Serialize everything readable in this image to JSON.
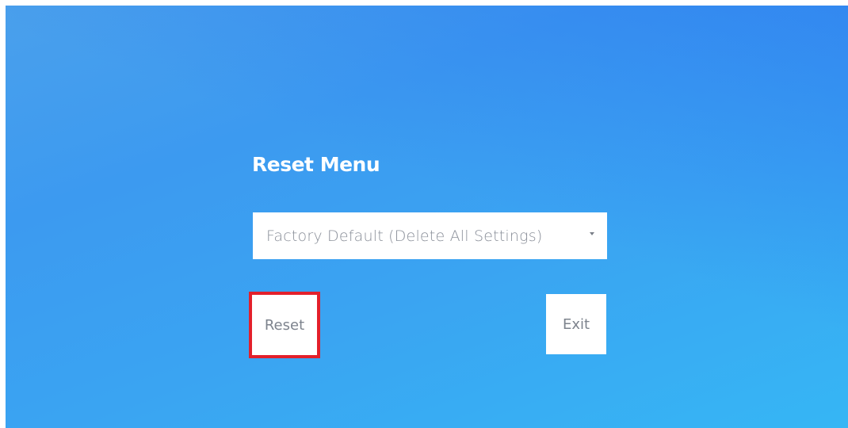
{
  "menu": {
    "title": "Reset Menu",
    "option_selected": "Factory Default (Delete All Settings)",
    "reset_label": "Reset",
    "exit_label": "Exit"
  },
  "colors": {
    "background_top": "#3c8cf0",
    "background_bottom": "#36b6f4",
    "highlight": "#e3202b",
    "text_muted": "#7d838d"
  },
  "icons": {
    "dropdown": "chevron-down-icon"
  }
}
